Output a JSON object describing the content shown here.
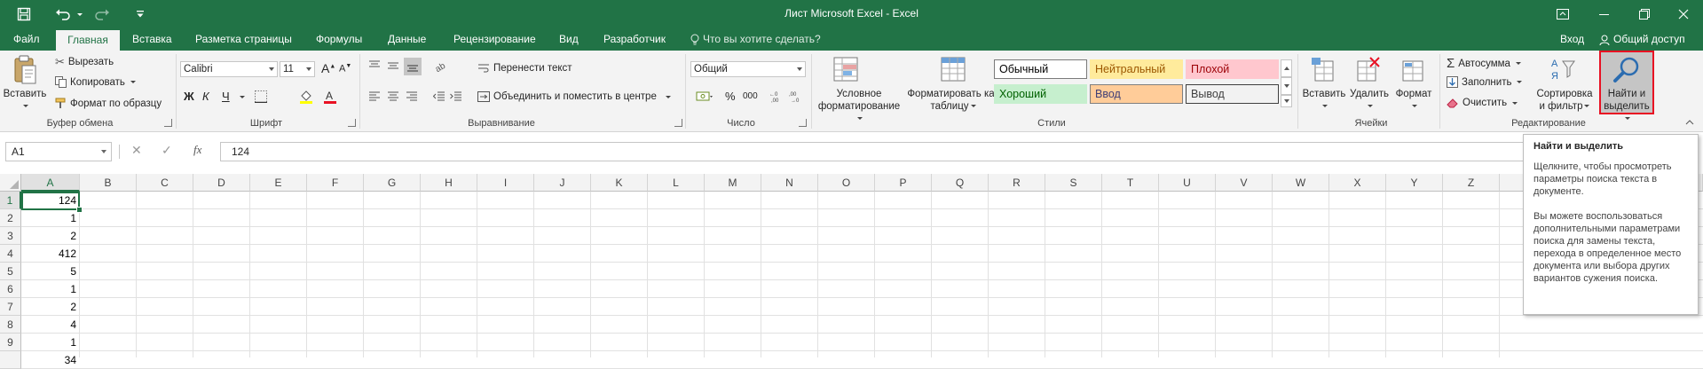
{
  "window": {
    "title": "Лист Microsoft Excel - Excel",
    "qat_icons": [
      "save-icon",
      "undo-icon",
      "redo-icon",
      "customize-icon"
    ],
    "controls": [
      "ribbon-display-icon",
      "minimize-icon",
      "restore-icon",
      "close-icon"
    ]
  },
  "tabs": {
    "file": "Файл",
    "items": [
      "Главная",
      "Вставка",
      "Разметка страницы",
      "Формулы",
      "Данные",
      "Рецензирование",
      "Вид",
      "Разработчик"
    ],
    "active": "Главная",
    "tell_me": "Что вы хотите сделать?",
    "signin": "Вход",
    "share": "Общий доступ"
  },
  "ribbon": {
    "clipboard": {
      "label": "Буфер обмена",
      "paste": "Вставить",
      "cut": "Вырезать",
      "copy": "Копировать",
      "format_painter": "Формат по образцу"
    },
    "font": {
      "label": "Шрифт",
      "font_name": "Calibri",
      "font_size": "11",
      "bold": "Ж",
      "italic": "К",
      "underline": "Ч",
      "grow": "A",
      "shrink": "A",
      "font_color": "#e81123",
      "fill_color": "#ffff00"
    },
    "alignment": {
      "label": "Выравнивание",
      "wrap": "Перенести текст",
      "merge": "Объединить и поместить в центре"
    },
    "number": {
      "label": "Число",
      "format": "Общий",
      "percent": "%",
      "comma": "000"
    },
    "styles": {
      "label": "Стили",
      "conditional": "Условное форматирование",
      "as_table": "Форматировать как таблицу",
      "cells": [
        {
          "name": "Обычный",
          "bg": "#ffffff",
          "fg": "#000000",
          "border": "#7a7a7a"
        },
        {
          "name": "Нейтральный",
          "bg": "#ffeb9c",
          "fg": "#9c5700",
          "border": "#ffeb9c"
        },
        {
          "name": "Плохой",
          "bg": "#ffc7ce",
          "fg": "#9c0006",
          "border": "#ffc7ce"
        },
        {
          "name": "Хороший",
          "bg": "#c6efce",
          "fg": "#006100",
          "border": "#c6efce"
        },
        {
          "name": "Ввод",
          "bg": "#ffcc99",
          "fg": "#3f3f76",
          "border": "#7f7f7f"
        },
        {
          "name": "Вывод",
          "bg": "#f2f2f2",
          "fg": "#3f3f3f",
          "border": "#3f3f3f"
        }
      ]
    },
    "cells": {
      "label": "Ячейки",
      "insert": "Вставить",
      "delete": "Удалить",
      "format": "Формат"
    },
    "editing": {
      "label": "Редактирование",
      "autosum": "Автосумма",
      "fill": "Заполнить",
      "clear": "Очистить",
      "sort_filter": "Сортировка и фильтр",
      "find_select": "Найти и выделить"
    }
  },
  "formula_bar": {
    "name_box": "A1",
    "fx": "fx",
    "value": "124"
  },
  "sheet": {
    "columns": [
      "A",
      "B",
      "C",
      "D",
      "E",
      "F",
      "G",
      "H",
      "I",
      "J",
      "K",
      "L",
      "M",
      "N",
      "O",
      "P",
      "Q",
      "R",
      "S",
      "T",
      "U",
      "V",
      "W",
      "X",
      "Y",
      "Z"
    ],
    "rows": [
      "1",
      "2",
      "3",
      "4",
      "5",
      "6",
      "7",
      "8",
      "9"
    ],
    "col_a_values": [
      "124",
      "1",
      "2",
      "412",
      "5",
      "1",
      "2",
      "4",
      "1"
    ],
    "partial_row_value": "34"
  },
  "tooltip": {
    "title": "Найти и выделить",
    "para1": "Щелкните, чтобы просмотреть параметры поиска текста в документе.",
    "para2": "Вы можете воспользоваться дополнительными параметрами поиска для замены текста, перехода в определенное место документа или выбора других вариантов сужения поиска."
  },
  "colors": {
    "excel_green": "#217346",
    "highlight_red": "#e81123"
  }
}
